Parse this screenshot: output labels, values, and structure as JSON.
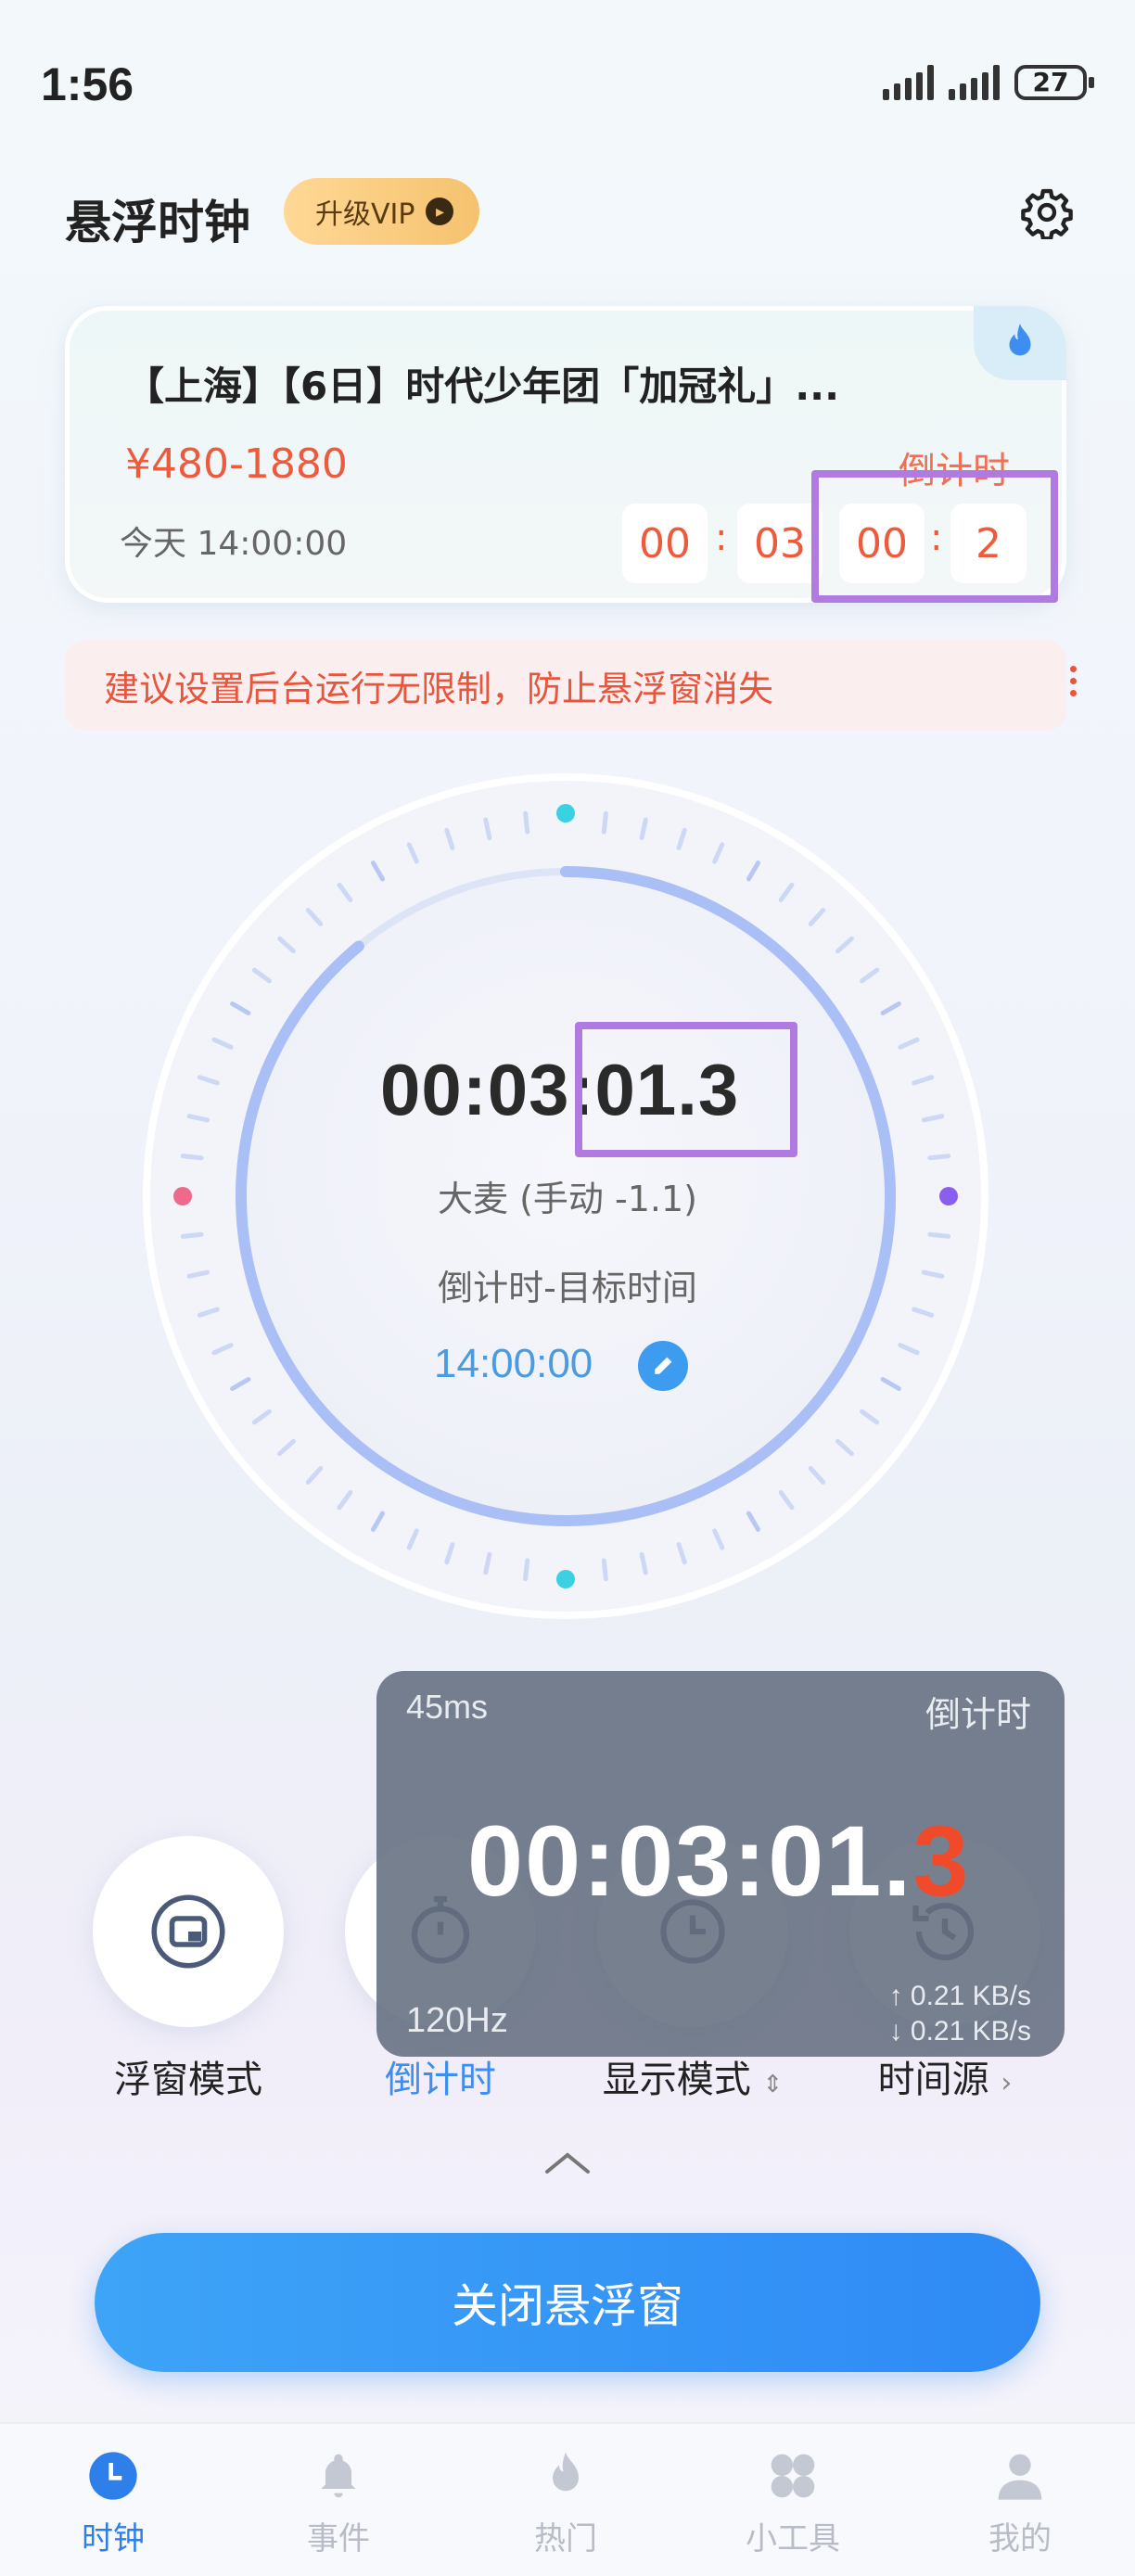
{
  "status_bar": {
    "time": "1:56",
    "battery": "27"
  },
  "header": {
    "title": "悬浮时钟",
    "vip_label": "升级VIP"
  },
  "event_card": {
    "title": "【上海】【6日】时代少年团「加冠礼」...",
    "price": "¥480-1880",
    "countdown_label": "倒计时",
    "date": "今天 14:00:00",
    "countdown": {
      "h": "00",
      "m": "03",
      "s": "00",
      "f": "2"
    }
  },
  "warning": {
    "text": "建议设置后台运行无限制，防止悬浮窗消失"
  },
  "dial": {
    "time": "00:03:01.3",
    "source": "大麦 (手动 -1.1)",
    "mode_label": "倒计时-目标时间",
    "target_time": "14:00:00",
    "progress": 0.89
  },
  "feature_buttons": [
    {
      "label": "浮窗模式",
      "icon": "float-window-icon"
    },
    {
      "label": "倒计时",
      "icon": "stopwatch-icon"
    },
    {
      "label": "显示模式",
      "icon": "clock-icon"
    },
    {
      "label": "时间源",
      "icon": "history-icon"
    }
  ],
  "overlay": {
    "latency": "45ms",
    "label": "倒计时",
    "time_main": "00:03:01.",
    "time_last": "3",
    "refresh_rate": "120Hz",
    "upload": "↑ 0.21 KB/s",
    "download": "↓ 0.21 KB/s"
  },
  "close_button": {
    "label": "关闭悬浮窗"
  },
  "tabs": [
    {
      "label": "时钟",
      "icon": "clock-icon",
      "active": true
    },
    {
      "label": "事件",
      "icon": "bell-icon"
    },
    {
      "label": "热门",
      "icon": "flame-icon"
    },
    {
      "label": "小工具",
      "icon": "tools-icon"
    },
    {
      "label": "我的",
      "icon": "user-icon"
    }
  ],
  "colors": {
    "accent": "#2f8af5",
    "countdown_red": "#ee5a3c",
    "highlight": "#b07ae0"
  }
}
